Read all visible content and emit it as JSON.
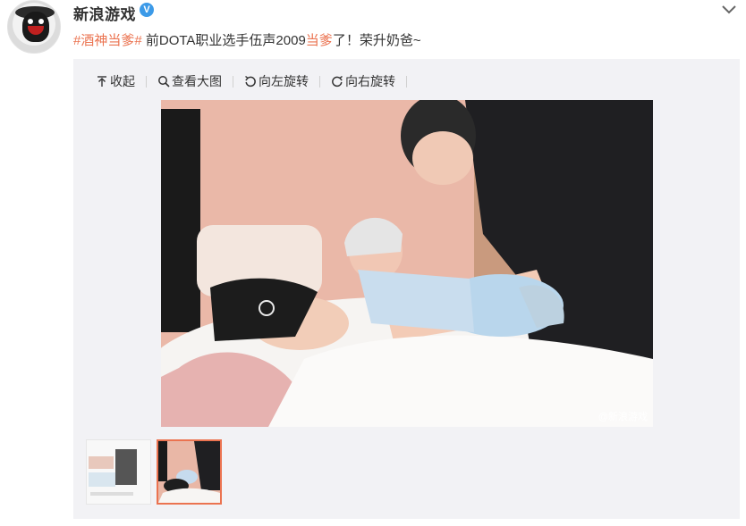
{
  "post": {
    "username": "新浪游戏",
    "verified_mark": "V",
    "text_parts": {
      "hash_open": "#",
      "topic": "酒神当爹",
      "hash_close": "#",
      "mid": " 前DOTA职业选手伍声2009",
      "highlight": "当爹",
      "tail": "了！荣升奶爸~"
    }
  },
  "toolbar": {
    "collapse": "收起",
    "view_large": "查看大图",
    "rotate_left": "向左旋转",
    "rotate_right": "向右旋转"
  },
  "photo": {
    "watermark": "@新浪游戏"
  },
  "thumbnails": [
    {
      "name": "thumb-1",
      "selected": false
    },
    {
      "name": "thumb-2",
      "selected": true
    }
  ],
  "colors": {
    "accent": "#eb7350",
    "verified": "#3c9ae8",
    "panel": "#f2f2f5"
  }
}
